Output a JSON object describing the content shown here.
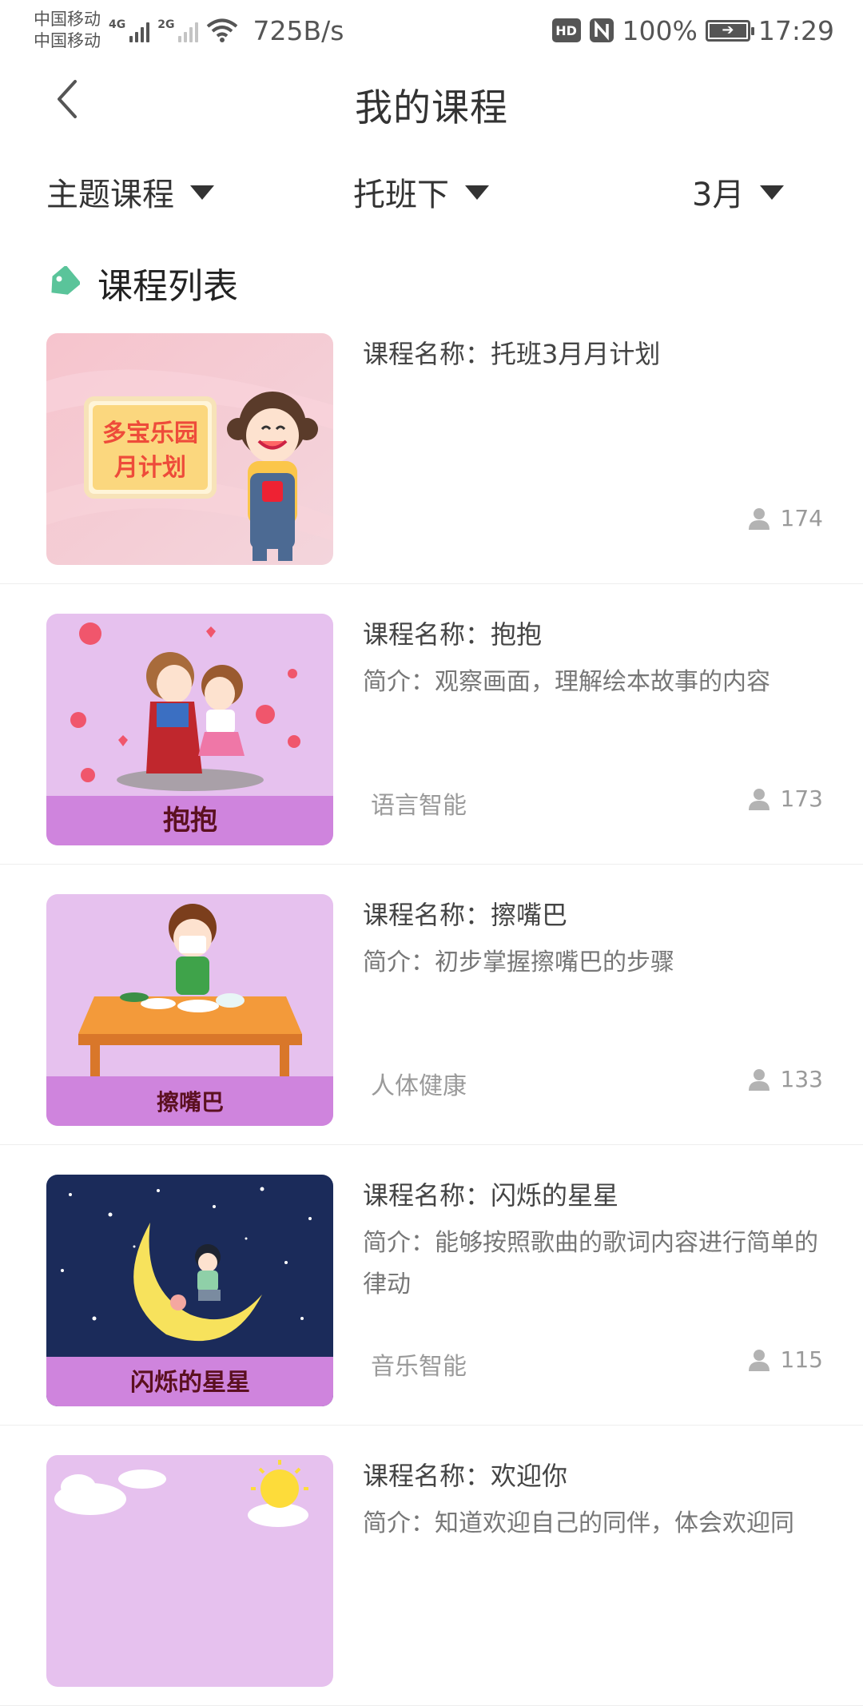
{
  "status_bar": {
    "carrier_1": "中国移动",
    "carrier_2": "中国移动",
    "net_1": "4G",
    "net_2": "2G",
    "speed": "725B/s",
    "hd_label": "HD",
    "battery": "100%",
    "time": "17:29",
    "icons": [
      "signal-icon",
      "wifi-icon",
      "nfc-icon",
      "battery-charging-icon"
    ]
  },
  "header": {
    "title": "我的课程",
    "back_icon": "chevron-left-icon"
  },
  "filters": [
    {
      "label": "主题课程"
    },
    {
      "label": "托班下"
    },
    {
      "label": "3月"
    }
  ],
  "section": {
    "title": "课程列表",
    "icon": "tag-icon",
    "accent_color": "#5ac49a"
  },
  "courses": [
    {
      "name": "课程名称：托班3月月计划",
      "desc": "",
      "category": "",
      "views": "174",
      "thumb_text": "多宝乐园\n月计划"
    },
    {
      "name": "课程名称：抱抱",
      "desc": "简介：观察画面，理解绘本故事的内容",
      "category": "语言智能",
      "views": "173",
      "thumb_text": "抱抱"
    },
    {
      "name": "课程名称：擦嘴巴",
      "desc": "简介：初步掌握擦嘴巴的步骤",
      "category": "人体健康",
      "views": "133",
      "thumb_text": "擦嘴巴"
    },
    {
      "name": "课程名称：闪烁的星星",
      "desc": "简介：能够按照歌曲的歌词内容进行简单的律动",
      "category": "音乐智能",
      "views": "115",
      "thumb_text": "闪烁的星星"
    },
    {
      "name": "课程名称：欢迎你",
      "desc": "简介：知道欢迎自己的同伴，体会欢迎同",
      "category": "",
      "views": "",
      "thumb_text": ""
    }
  ],
  "colors": {
    "thumb_purple": "#e6c1ee",
    "thumb_band": "#cf84dd",
    "night_sky": "#1b2b5a"
  }
}
